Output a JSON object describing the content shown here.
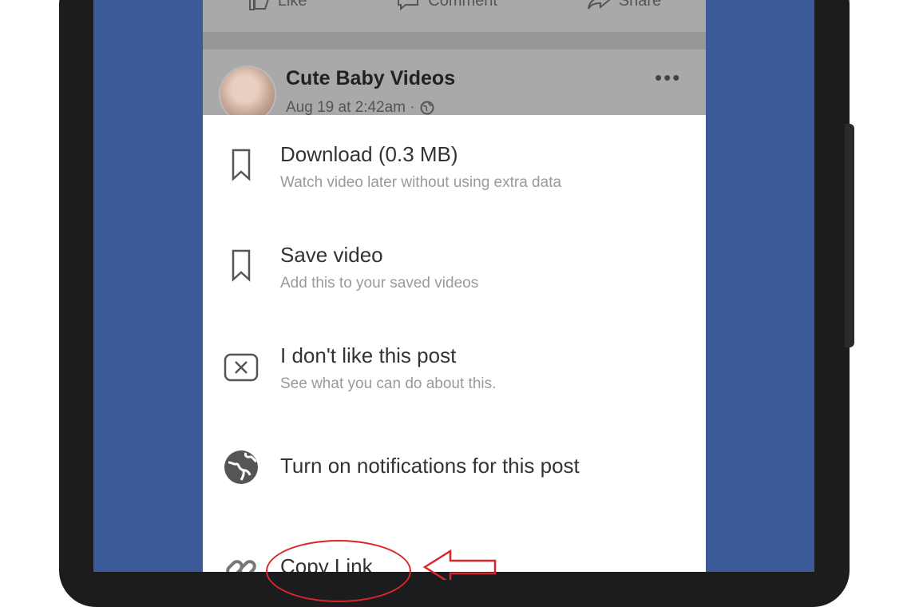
{
  "actions": {
    "like": "Like",
    "comment": "Comment",
    "share": "Share"
  },
  "post": {
    "title": "Cute Baby Videos",
    "meta": "Aug 19 at 2:42am ·",
    "more": "•••"
  },
  "menu": {
    "items": [
      {
        "label": "Download (0.3 MB)",
        "sub": "Watch video later without using extra data",
        "icon": "bookmark-icon"
      },
      {
        "label": "Save video",
        "sub": "Add this to your saved videos",
        "icon": "bookmark-icon"
      },
      {
        "label": "I don't like this post",
        "sub": "See what you can do about this.",
        "icon": "close-box-icon"
      },
      {
        "label": "Turn on notifications for this post",
        "sub": "",
        "icon": "globe-icon"
      },
      {
        "label": "Copy Link",
        "sub": "",
        "icon": "link-icon"
      }
    ]
  },
  "colors": {
    "screen_bg": "#3d5a98",
    "annotation": "#d9262b"
  }
}
